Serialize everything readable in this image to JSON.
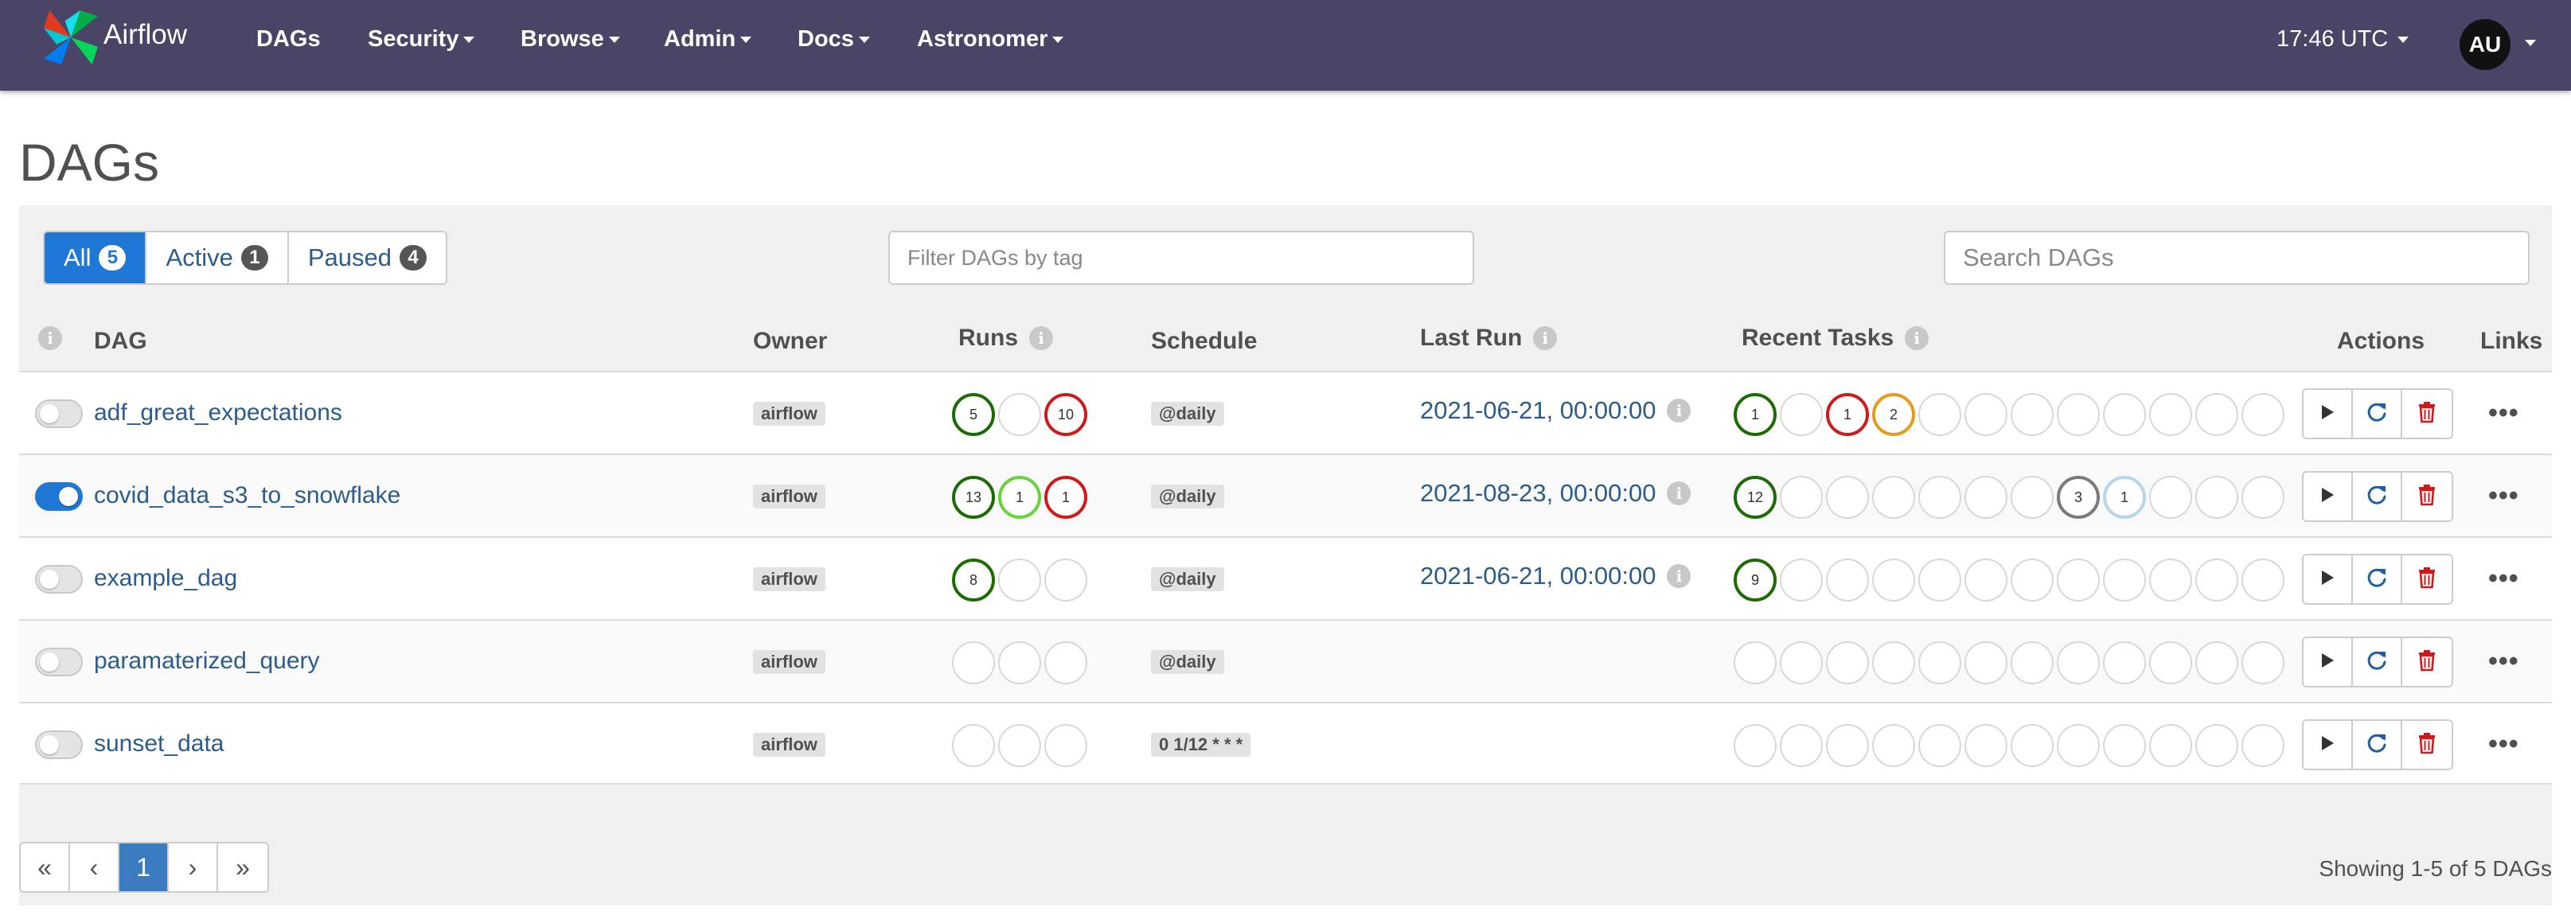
{
  "navbar": {
    "brand": "Airflow",
    "items": [
      {
        "label": "DAGs",
        "dropdown": false
      },
      {
        "label": "Security",
        "dropdown": true
      },
      {
        "label": "Browse",
        "dropdown": true
      },
      {
        "label": "Admin",
        "dropdown": true
      },
      {
        "label": "Docs",
        "dropdown": true
      },
      {
        "label": "Astronomer",
        "dropdown": true
      }
    ],
    "time": "17:46 UTC",
    "user_initials": "AU",
    "bg_color": "#4a4566"
  },
  "page_title": "DAGs",
  "filters": [
    {
      "label": "All",
      "count": "5",
      "active": true
    },
    {
      "label": "Active",
      "count": "1",
      "active": false
    },
    {
      "label": "Paused",
      "count": "4",
      "active": false
    }
  ],
  "tag_filter_placeholder": "Filter DAGs by tag",
  "search_placeholder": "Search DAGs",
  "columns": {
    "dag": "DAG",
    "owner": "Owner",
    "runs": "Runs",
    "schedule": "Schedule",
    "last_run": "Last Run",
    "recent_tasks": "Recent Tasks",
    "actions": "Actions",
    "links": "Links"
  },
  "status_colors": {
    "success": "#1c6b05",
    "running": "#6ad33c",
    "failed": "#d01a1a",
    "upstream_failed": "#e89a1b",
    "skipped_like": "#7a7a7a",
    "scheduled": "#b5d6ec",
    "empty": "#d8d8d8"
  },
  "dags": [
    {
      "name": "adf_great_expectations",
      "active": false,
      "owner": "airflow",
      "schedule": "@daily",
      "last_run": "2021-06-21, 00:00:00",
      "runs": [
        {
          "count": "5",
          "color": "#1c6b05"
        },
        {
          "count": "",
          "color": "#d8d8d8"
        },
        {
          "count": "10",
          "color": "#d01a1a"
        }
      ],
      "tasks": [
        {
          "count": "1",
          "color": "#1c6b05"
        },
        {
          "count": "",
          "color": "#d8d8d8"
        },
        {
          "count": "1",
          "color": "#d01a1a"
        },
        {
          "count": "2",
          "color": "#e89a1b"
        },
        {
          "count": "",
          "color": "#d8d8d8"
        },
        {
          "count": "",
          "color": "#d8d8d8"
        },
        {
          "count": "",
          "color": "#d8d8d8"
        },
        {
          "count": "",
          "color": "#d8d8d8"
        },
        {
          "count": "",
          "color": "#d8d8d8"
        },
        {
          "count": "",
          "color": "#d8d8d8"
        },
        {
          "count": "",
          "color": "#d8d8d8"
        },
        {
          "count": "",
          "color": "#d8d8d8"
        }
      ]
    },
    {
      "name": "covid_data_s3_to_snowflake",
      "active": true,
      "owner": "airflow",
      "schedule": "@daily",
      "last_run": "2021-08-23, 00:00:00",
      "runs": [
        {
          "count": "13",
          "color": "#1c6b05"
        },
        {
          "count": "1",
          "color": "#6ad33c"
        },
        {
          "count": "1",
          "color": "#d01a1a"
        }
      ],
      "tasks": [
        {
          "count": "12",
          "color": "#1c6b05"
        },
        {
          "count": "",
          "color": "#d8d8d8"
        },
        {
          "count": "",
          "color": "#d8d8d8"
        },
        {
          "count": "",
          "color": "#d8d8d8"
        },
        {
          "count": "",
          "color": "#d8d8d8"
        },
        {
          "count": "",
          "color": "#d8d8d8"
        },
        {
          "count": "",
          "color": "#d8d8d8"
        },
        {
          "count": "3",
          "color": "#7a7a7a"
        },
        {
          "count": "1",
          "color": "#b5d6ec"
        },
        {
          "count": "",
          "color": "#d8d8d8"
        },
        {
          "count": "",
          "color": "#d8d8d8"
        },
        {
          "count": "",
          "color": "#d8d8d8"
        }
      ]
    },
    {
      "name": "example_dag",
      "active": false,
      "owner": "airflow",
      "schedule": "@daily",
      "last_run": "2021-06-21, 00:00:00",
      "runs": [
        {
          "count": "8",
          "color": "#1c6b05"
        },
        {
          "count": "",
          "color": "#d8d8d8"
        },
        {
          "count": "",
          "color": "#d8d8d8"
        }
      ],
      "tasks": [
        {
          "count": "9",
          "color": "#1c6b05"
        },
        {
          "count": "",
          "color": "#d8d8d8"
        },
        {
          "count": "",
          "color": "#d8d8d8"
        },
        {
          "count": "",
          "color": "#d8d8d8"
        },
        {
          "count": "",
          "color": "#d8d8d8"
        },
        {
          "count": "",
          "color": "#d8d8d8"
        },
        {
          "count": "",
          "color": "#d8d8d8"
        },
        {
          "count": "",
          "color": "#d8d8d8"
        },
        {
          "count": "",
          "color": "#d8d8d8"
        },
        {
          "count": "",
          "color": "#d8d8d8"
        },
        {
          "count": "",
          "color": "#d8d8d8"
        },
        {
          "count": "",
          "color": "#d8d8d8"
        }
      ]
    },
    {
      "name": "paramaterized_query",
      "active": false,
      "owner": "airflow",
      "schedule": "@daily",
      "last_run": "",
      "runs": [
        {
          "count": "",
          "color": "#d8d8d8"
        },
        {
          "count": "",
          "color": "#d8d8d8"
        },
        {
          "count": "",
          "color": "#d8d8d8"
        }
      ],
      "tasks": [
        {
          "count": "",
          "color": "#d8d8d8"
        },
        {
          "count": "",
          "color": "#d8d8d8"
        },
        {
          "count": "",
          "color": "#d8d8d8"
        },
        {
          "count": "",
          "color": "#d8d8d8"
        },
        {
          "count": "",
          "color": "#d8d8d8"
        },
        {
          "count": "",
          "color": "#d8d8d8"
        },
        {
          "count": "",
          "color": "#d8d8d8"
        },
        {
          "count": "",
          "color": "#d8d8d8"
        },
        {
          "count": "",
          "color": "#d8d8d8"
        },
        {
          "count": "",
          "color": "#d8d8d8"
        },
        {
          "count": "",
          "color": "#d8d8d8"
        },
        {
          "count": "",
          "color": "#d8d8d8"
        }
      ]
    },
    {
      "name": "sunset_data",
      "active": false,
      "owner": "airflow",
      "schedule": "0 1/12 * * *",
      "last_run": "",
      "runs": [
        {
          "count": "",
          "color": "#d8d8d8"
        },
        {
          "count": "",
          "color": "#d8d8d8"
        },
        {
          "count": "",
          "color": "#d8d8d8"
        }
      ],
      "tasks": [
        {
          "count": "",
          "color": "#d8d8d8"
        },
        {
          "count": "",
          "color": "#d8d8d8"
        },
        {
          "count": "",
          "color": "#d8d8d8"
        },
        {
          "count": "",
          "color": "#d8d8d8"
        },
        {
          "count": "",
          "color": "#d8d8d8"
        },
        {
          "count": "",
          "color": "#d8d8d8"
        },
        {
          "count": "",
          "color": "#d8d8d8"
        },
        {
          "count": "",
          "color": "#d8d8d8"
        },
        {
          "count": "",
          "color": "#d8d8d8"
        },
        {
          "count": "",
          "color": "#d8d8d8"
        },
        {
          "count": "",
          "color": "#d8d8d8"
        },
        {
          "count": "",
          "color": "#d8d8d8"
        }
      ]
    }
  ],
  "row_actions": [
    {
      "icon": "play-icon",
      "color": "#333333"
    },
    {
      "icon": "refresh-icon",
      "color": "#1f5fa6"
    },
    {
      "icon": "trash-icon",
      "color": "#d01a1a"
    }
  ],
  "links_label": "•••",
  "pagination": {
    "first": "«",
    "prev": "‹",
    "current": "1",
    "next": "›",
    "last": "»"
  },
  "showing": "Showing 1-5 of 5 DAGs"
}
